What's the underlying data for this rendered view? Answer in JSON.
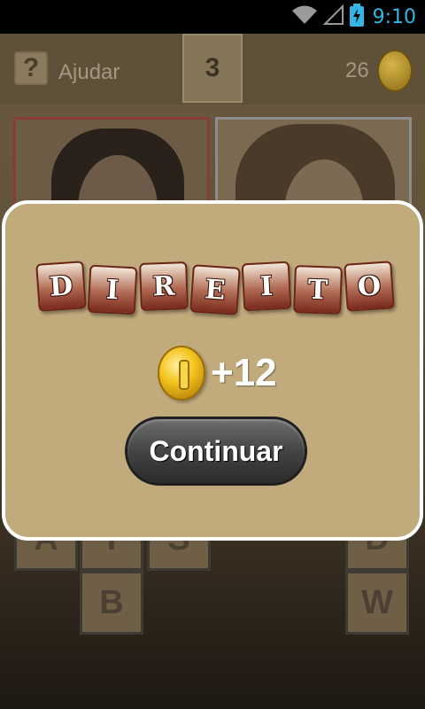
{
  "status_bar": {
    "time": "9:10",
    "icons": [
      "wifi-icon",
      "signal-icon",
      "battery-charging-icon"
    ]
  },
  "header": {
    "help_icon_glyph": "?",
    "help_label": "Ajudar",
    "level": "3",
    "coins": "26"
  },
  "tiles": {
    "row1": [
      "A",
      "T",
      "S",
      "D"
    ],
    "row2_left": "B",
    "row2_right": "W"
  },
  "modal": {
    "word_letters": [
      "D",
      "I",
      "R",
      "E",
      "I",
      "T",
      "O"
    ],
    "reward": "+12",
    "continue_label": "Continuar"
  },
  "colors": {
    "modal_bg": "#c1aa7c",
    "letter_tile_dark": "#7a2a1c",
    "clock": "#33b5e5"
  }
}
